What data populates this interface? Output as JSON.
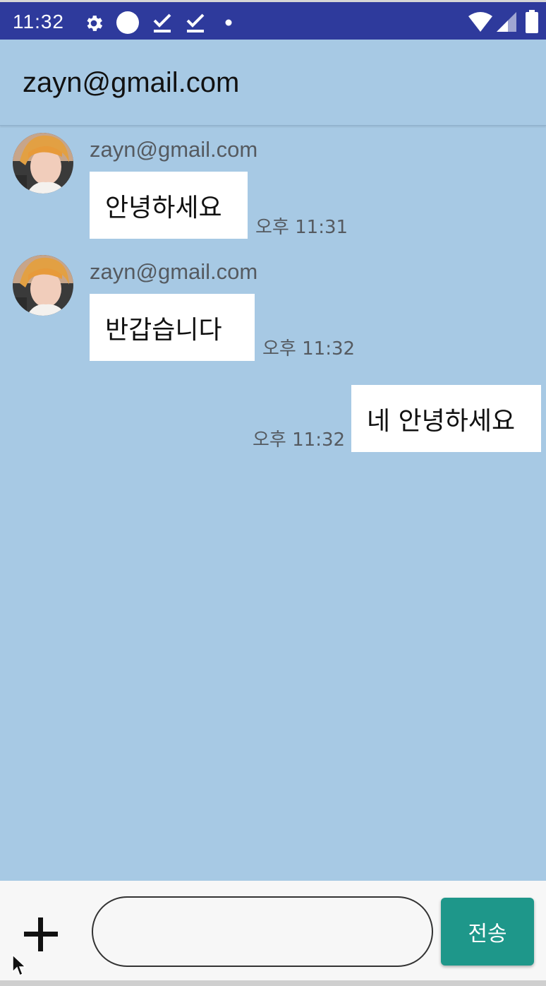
{
  "status_bar": {
    "time": "11:32",
    "icons": [
      "gear-icon",
      "circle-icon",
      "download-check-icon",
      "download-check-icon",
      "dot-icon",
      "wifi-icon",
      "signal-icon",
      "battery-icon"
    ],
    "color": "#2e3a9c"
  },
  "app_bar": {
    "title": "zayn@gmail.com",
    "background": "#a7c9e4"
  },
  "messages": [
    {
      "direction": "incoming",
      "sender": "zayn@gmail.com",
      "text": "안녕하세요",
      "time": "오후 11:31"
    },
    {
      "direction": "incoming",
      "sender": "zayn@gmail.com",
      "text": "반갑습니다",
      "time": "오후 11:32"
    },
    {
      "direction": "outgoing",
      "text": "네 안녕하세요",
      "time": "오후 11:32"
    }
  ],
  "input_bar": {
    "add_icon": "plus-icon",
    "input_value": "",
    "input_placeholder": "",
    "send_label": "전송",
    "send_color": "#1e978a"
  }
}
